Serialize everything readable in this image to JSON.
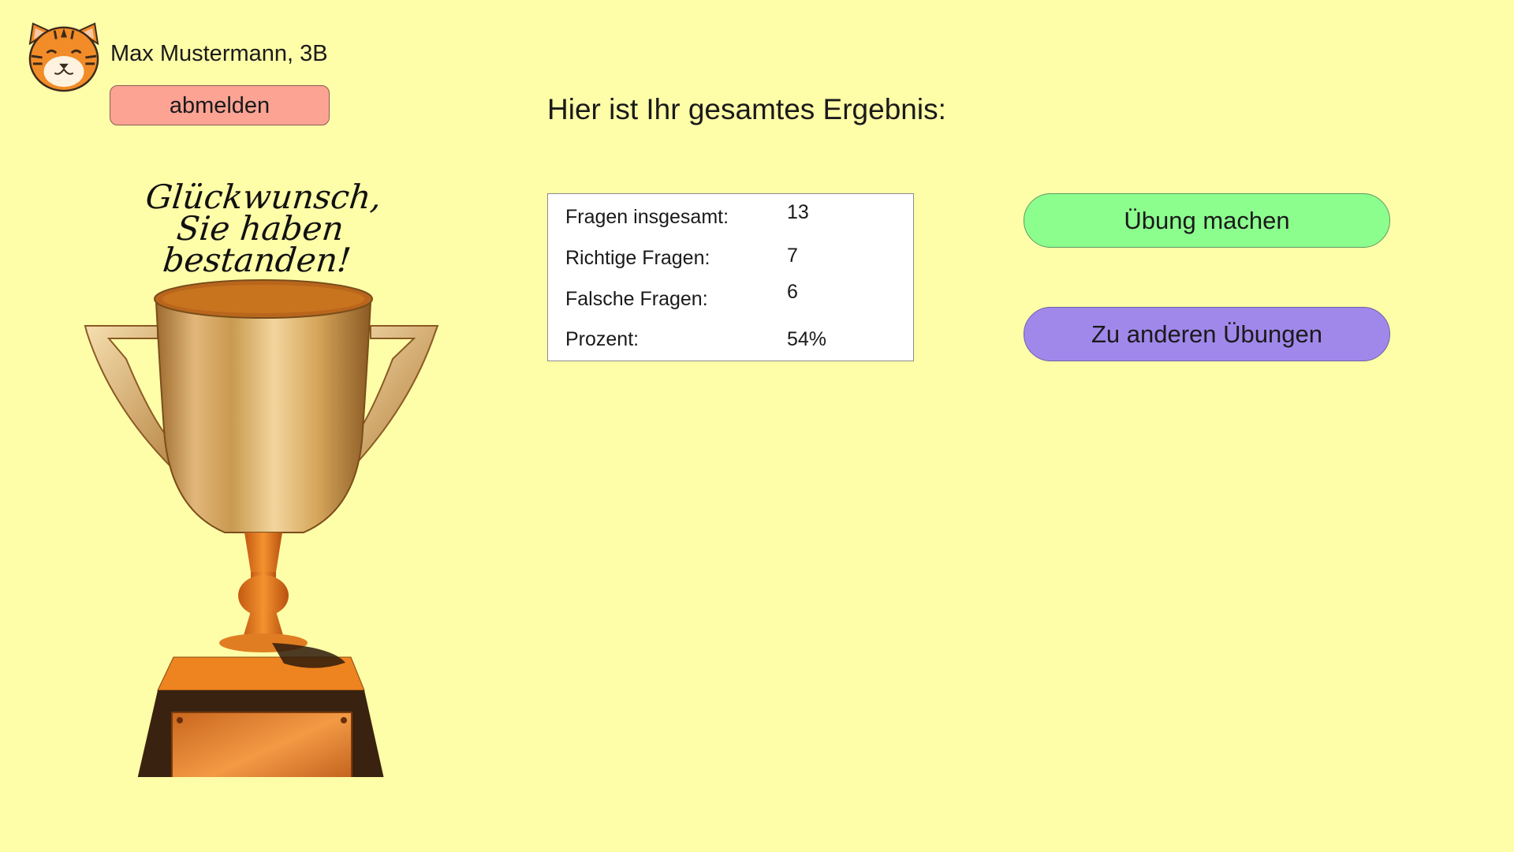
{
  "header": {
    "user_name": "Max Mustermann, 3B",
    "logout_label": "abmelden",
    "avatar_icon": "tiger-face-icon"
  },
  "main": {
    "title": "Hier ist Ihr gesamtes Ergebnis:",
    "results": [
      {
        "label": "Fragen insgesamt:",
        "value": "13"
      },
      {
        "label": "Richtige Fragen:",
        "value": "7"
      },
      {
        "label": "Falsche Fragen:",
        "value": "6"
      },
      {
        "label": "Prozent:",
        "value": "54%"
      }
    ]
  },
  "award": {
    "line1": "Glückwunsch,",
    "line2": "Sie haben bestanden!",
    "image_icon": "trophy-icon"
  },
  "actions": {
    "exercise_label": "Übung machen",
    "other_label": "Zu anderen Übungen"
  },
  "colors": {
    "background": "#fefda8",
    "logout": "#fca394",
    "exercise": "#8cfe8e",
    "other": "#a088eb"
  }
}
